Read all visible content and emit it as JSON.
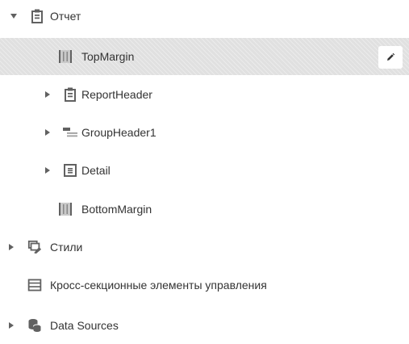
{
  "tree": {
    "report": {
      "label": "Отчет",
      "icon": "report-icon",
      "expanded": true
    },
    "bands": [
      {
        "label": "TopMargin",
        "icon": "margin-band-icon",
        "selected": true
      },
      {
        "label": "ReportHeader",
        "icon": "report-header-icon",
        "expandable": true
      },
      {
        "label": "GroupHeader1",
        "icon": "group-header-icon",
        "expandable": true
      },
      {
        "label": "Detail",
        "icon": "detail-band-icon",
        "expandable": true
      },
      {
        "label": "BottomMargin",
        "icon": "margin-band-icon"
      }
    ],
    "styles": {
      "label": "Стили",
      "icon": "styles-icon"
    },
    "cross_band": {
      "label": "Кросс-секционные элементы управления",
      "icon": "cross-band-icon"
    },
    "data_sources": {
      "label": "Data Sources",
      "icon": "data-sources-icon"
    }
  },
  "actions": {
    "edit_icon": "pencil-icon"
  },
  "colors": {
    "selected_bg": "#e0e0e0",
    "icon": "#616161",
    "text": "#333333"
  }
}
